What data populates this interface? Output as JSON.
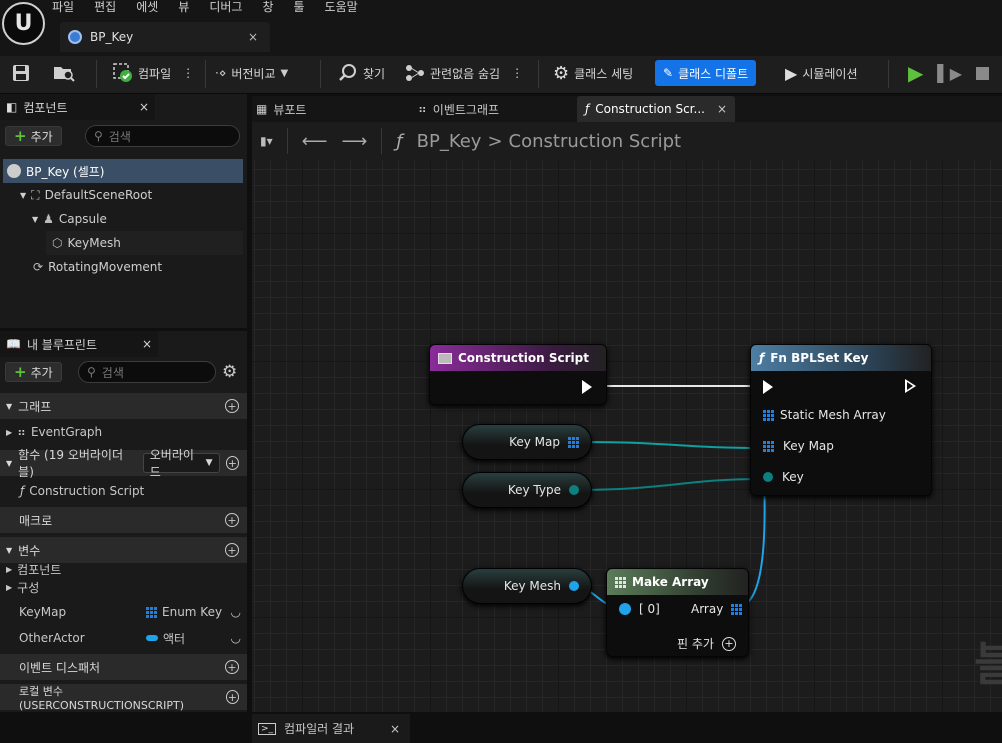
{
  "menu": [
    "파일",
    "편집",
    "에셋",
    "뷰",
    "디버그",
    "창",
    "툴",
    "도움말"
  ],
  "doc_tab": {
    "title": "BP_Key",
    "close": "×"
  },
  "toolbar": {
    "compile": "컴파일",
    "version": "버전비교",
    "find": "찾기",
    "hide_unrelated": "관련없음 숨김",
    "class_settings": "클래스 세팅",
    "class_defaults": "클래스 디폴트",
    "simulation": "시뮬레이션"
  },
  "components_panel": {
    "title": "컴포넌트",
    "close": "×",
    "add": "추가",
    "search_placeholder": "검색",
    "tree": [
      {
        "label": "BP_Key (셀프)"
      },
      {
        "label": "DefaultSceneRoot"
      },
      {
        "label": "Capsule"
      },
      {
        "label": "KeyMesh"
      },
      {
        "label": "RotatingMovement"
      }
    ]
  },
  "my_blueprint": {
    "title": "내 블루프린트",
    "close": "×",
    "add": "추가",
    "search_placeholder": "검색",
    "graphs_cat": "그래프",
    "event_graph": "EventGraph",
    "functions_cat": "함수 (19 오버라이더블)",
    "override_btn": "오버라이드",
    "construction_script": "Construction Script",
    "macros_cat": "매크로",
    "variables_cat": "변수",
    "var_components": "컴포넌트",
    "var_config": "구성",
    "variables": [
      {
        "name": "KeyMap",
        "type": "Enum Key"
      },
      {
        "name": "OtherActor",
        "type": "액터"
      }
    ],
    "dispatchers_cat": "이벤트 디스패처",
    "local_vars_cat": "로컬 변수 (USERCONSTRUCTIONSCRIPT)"
  },
  "editor_tabs": {
    "viewport": "뷰포트",
    "event_graph": "이벤트그래프",
    "construction": "Construction Scr...",
    "close": "×"
  },
  "breadcrumb": {
    "root": "BP_Key",
    "sep": ">",
    "current": "Construction Script"
  },
  "nodes": {
    "construction_script": "Construction Script",
    "fn_set_key": "Fn BPLSet Key",
    "pin_static_mesh_array": "Static Mesh Array",
    "pin_key_map": "Key Map",
    "pin_key": "Key",
    "get_key_map": "Key Map",
    "get_key_type": "Key Type",
    "get_key_mesh": "Key Mesh",
    "make_array": "Make Array",
    "pin_index0": "[ 0]",
    "pin_array": "Array",
    "add_pin": "핀 추가"
  },
  "watermark": "블",
  "bottom_tab": {
    "label": "컴파일러 결과",
    "close": "×"
  },
  "colors": {
    "accent": "#1473e6",
    "struct_pin": "#0fa0a0",
    "object_pin": "#1fa4ea",
    "func_header": "#3a5d7a",
    "event_header": "#7a2b8a",
    "pure_header": "#4a6a4a"
  }
}
